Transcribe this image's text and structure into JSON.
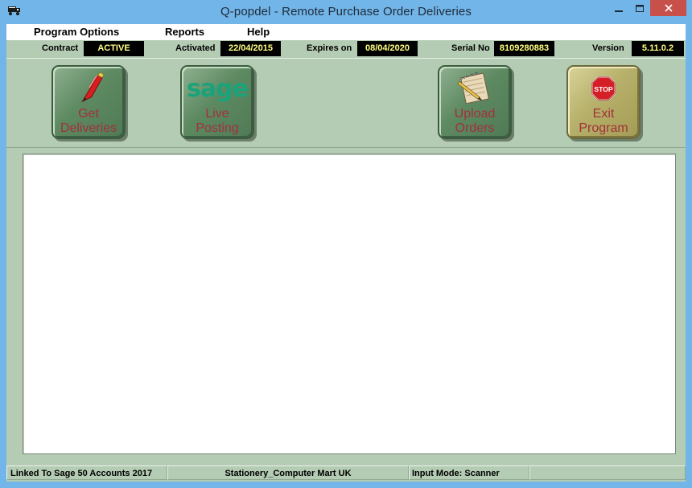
{
  "window": {
    "title": "Q-popdel - Remote Purchase Order Deliveries"
  },
  "menu": {
    "items": [
      "Program Options",
      "Reports",
      "Help"
    ]
  },
  "info": {
    "contract_label": "Contract",
    "contract_value": "ACTIVE",
    "activated_label": "Activated",
    "activated_value": "22/04/2015",
    "expires_label": "Expires on",
    "expires_value": "08/04/2020",
    "serial_label": "Serial No",
    "serial_value": "8109280883",
    "version_label": "Version",
    "version_value": "5.11.0.2"
  },
  "toolbar": {
    "get_deliveries": {
      "line1": "Get",
      "line2": "Deliveries",
      "icon": "pen-icon"
    },
    "live_posting": {
      "line1": "Live",
      "line2": "Posting",
      "icon": "sage-logo",
      "logo_text": "sage"
    },
    "upload_orders": {
      "line1": "Upload",
      "line2": "Orders",
      "icon": "notepad-icon"
    },
    "exit_program": {
      "line1": "Exit",
      "line2": "Program",
      "icon": "stop-sign-icon",
      "sign_text": "STOP"
    }
  },
  "status": {
    "linked": "Linked To Sage 50 Accounts 2017",
    "company": "Stationery_Computer Mart UK",
    "input_mode": "Input Mode: Scanner",
    "extra": ""
  },
  "colors": {
    "panel": "#b4cbb4",
    "button_label": "#a2313a",
    "value_text": "#ffff80",
    "title_bar": "#72b5e8",
    "close_button": "#c7504a"
  }
}
